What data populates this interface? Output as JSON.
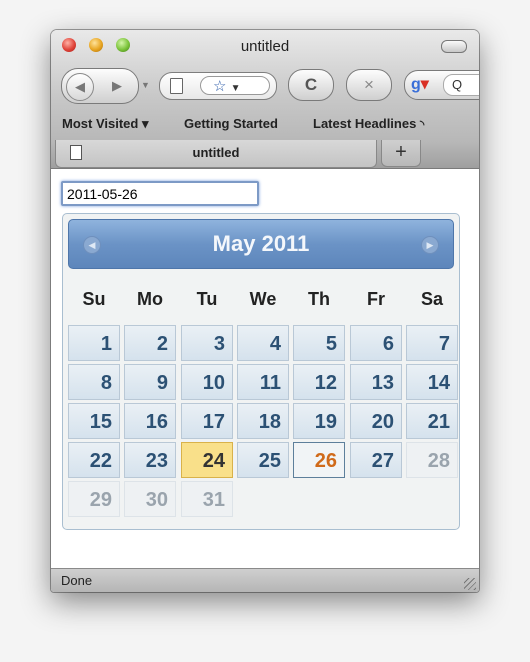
{
  "window": {
    "title": "untitled"
  },
  "toolbar": {
    "back_icon": "back-arrow",
    "forward_icon": "forward-arrow",
    "reload_glyph": "C",
    "stop_glyph": "×",
    "search_glyph": "Q"
  },
  "bookmarks": [
    {
      "label": "Most Visited ▾"
    },
    {
      "label": "Getting Started"
    },
    {
      "label": "Latest Headlines"
    }
  ],
  "tab": {
    "label": "untitled",
    "new_tab_label": "+"
  },
  "date_input": {
    "value": "2011-05-26"
  },
  "datepicker": {
    "title": "May 2011",
    "prev_glyph": "◀",
    "next_glyph": "▶",
    "weekdays": [
      "Su",
      "Mo",
      "Tu",
      "We",
      "Th",
      "Fr",
      "Sa"
    ],
    "today": "24",
    "selected": "26",
    "weeks": [
      [
        {
          "d": "1"
        },
        {
          "d": "2"
        },
        {
          "d": "3"
        },
        {
          "d": "4"
        },
        {
          "d": "5"
        },
        {
          "d": "6"
        },
        {
          "d": "7"
        }
      ],
      [
        {
          "d": "8"
        },
        {
          "d": "9"
        },
        {
          "d": "10"
        },
        {
          "d": "11"
        },
        {
          "d": "12"
        },
        {
          "d": "13"
        },
        {
          "d": "14"
        }
      ],
      [
        {
          "d": "15"
        },
        {
          "d": "16"
        },
        {
          "d": "17"
        },
        {
          "d": "18"
        },
        {
          "d": "19"
        },
        {
          "d": "20"
        },
        {
          "d": "21"
        }
      ],
      [
        {
          "d": "22"
        },
        {
          "d": "23"
        },
        {
          "d": "24",
          "state": "today"
        },
        {
          "d": "25"
        },
        {
          "d": "26",
          "state": "selected"
        },
        {
          "d": "27"
        },
        {
          "d": "28",
          "state": "other"
        }
      ],
      [
        {
          "d": "29",
          "state": "other"
        },
        {
          "d": "30",
          "state": "other"
        },
        {
          "d": "31",
          "state": "other"
        }
      ]
    ]
  },
  "status": {
    "text": "Done"
  },
  "colors": {
    "header": "#6b93c6",
    "today": "#f9e08a",
    "selected_text": "#d06a1a",
    "day_text": "#2c5174"
  }
}
